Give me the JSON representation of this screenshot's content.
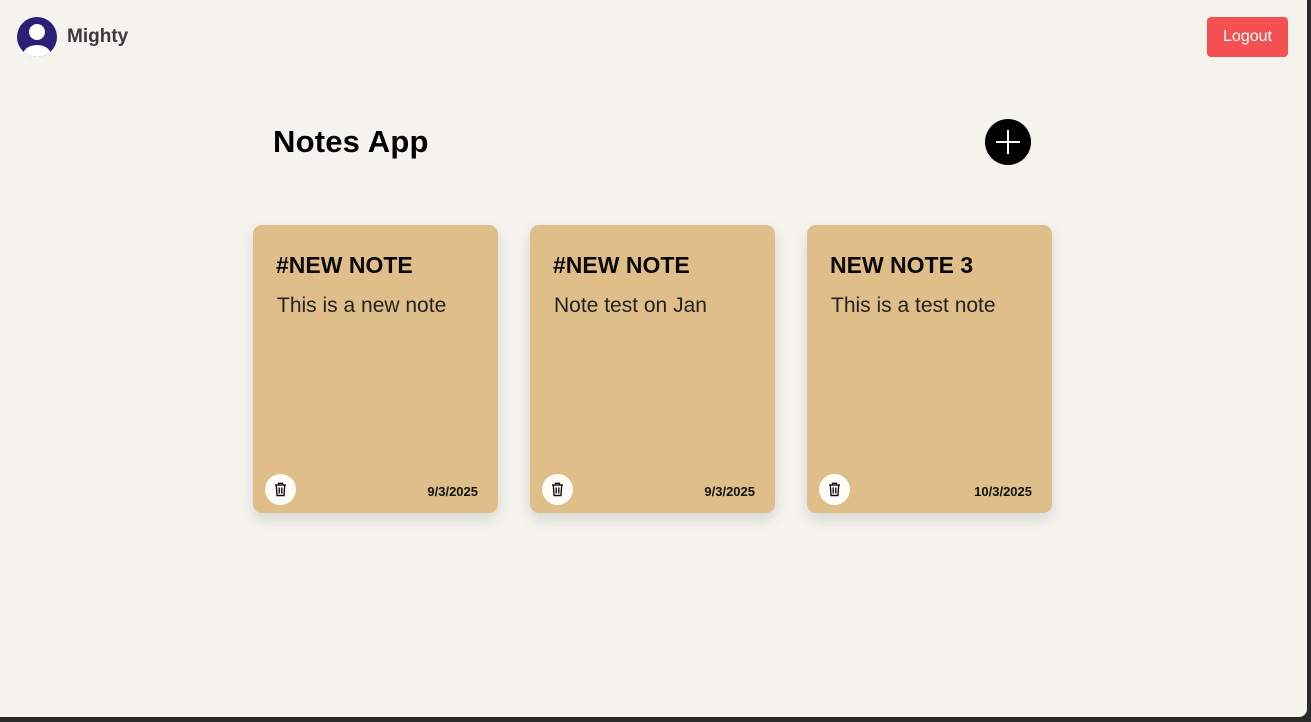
{
  "header": {
    "username": "Mighty",
    "logout_label": "Logout",
    "avatar_icon": "user-avatar-icon"
  },
  "main": {
    "title": "Notes App",
    "add_icon": "plus-icon"
  },
  "notes": [
    {
      "title": "#NEW NOTE",
      "body": "This is a new note",
      "date": "9/3/2025"
    },
    {
      "title": "#NEW NOTE",
      "body": "Note test on Jan",
      "date": "9/3/2025"
    },
    {
      "title": "NEW NOTE 3",
      "body": "This is a test note",
      "date": "10/3/2025"
    }
  ],
  "colors": {
    "background": "#f5f3ee",
    "card": "#dfbe8a",
    "logout": "#f55152",
    "avatar": "#2a2177"
  }
}
